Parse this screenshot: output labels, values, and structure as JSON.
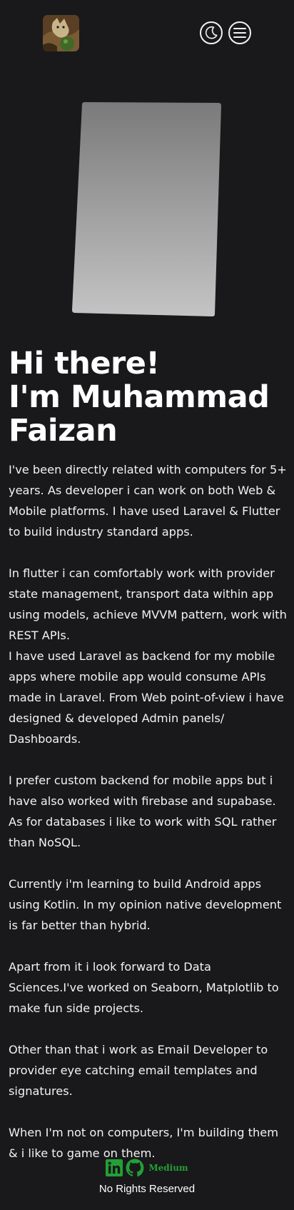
{
  "header": {
    "avatar_alt": "profile photo",
    "icons": [
      "moon-icon",
      "menu-icon"
    ]
  },
  "intro": {
    "greeting": "Hi there!",
    "name_line1": "I'm Muhammad",
    "name_line2": "Faizan"
  },
  "bio": {
    "p1": "I've been directly related with computers for 5+ years. As developer i can work on both Web & Mobile platforms. I have used Laravel & Flutter to build industry standard apps.",
    "p2": "In flutter i can comfortably work with provider state management, transport data within app using models, achieve MVVM pattern, work with REST APIs.",
    "p3": "I have used Laravel as backend for my mobile apps where mobile app would consume APIs made in Laravel. From Web point-of-view i have designed & developed Admin panels/ Dashboards.",
    "p4": "I prefer custom backend for mobile apps but i have also worked with firebase and supabase. As for databases i like to work with SQL rather than NoSQL.",
    "p5": "Currently i'm learning to build Android apps using Kotlin. In my opinion native development is far better than hybrid.",
    "p6": "Apart from it i look forward to Data Sciences.I've worked on Seaborn, Matplotlib to make fun side projects.",
    "p7": "Other than that i work as Email Developer to provider eye catching email templates and signatures.",
    "p8": "When I'm not on computers, I'm building them & i like to game on them."
  },
  "footer": {
    "medium_label": "Medium",
    "copyright": "No Rights Reserved",
    "accent_color": "#22a035",
    "icons": [
      "linkedin-icon",
      "github-icon"
    ]
  }
}
